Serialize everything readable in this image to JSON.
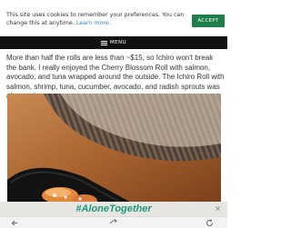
{
  "cookie_bar": {
    "message": "This site uses cookies to remember your preferences. You can change this at anytime.",
    "link_text": "Learn more.",
    "accept_label": "Accept"
  },
  "navbar": {
    "menu_label": "MENU",
    "icon": "hamburger-icon"
  },
  "article": {
    "paragraph": "More than half the rolls are less than ~$15, so Ichiro won't break the bank. I really enjoyed the Cherry Blossom Roll with salmon, avocado, and tuna wrapped around the outside. The Ichiro Roll with salmon, shrimp, tuna, cucumber, avocado, and radish sprouts was also a winner."
  },
  "ad": {
    "hashtag": "#AloneTogether",
    "close_label": "×"
  },
  "browser_bar": {
    "icons": [
      "back-arrow-icon",
      "share-icon",
      "refresh-icon"
    ]
  },
  "colors": {
    "accept_button": "#1e7e4a",
    "navbar": "#111111",
    "link": "#2e86c1",
    "hashtag": "#1a9a7c"
  }
}
